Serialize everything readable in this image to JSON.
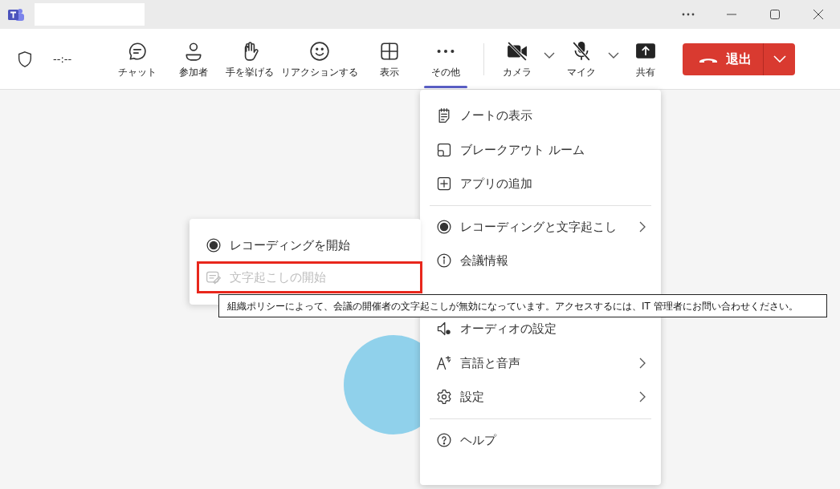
{
  "title_bar": {
    "controls": [
      {
        "kind": "more"
      },
      {
        "kind": "minimize"
      },
      {
        "kind": "maximize"
      },
      {
        "kind": "close"
      }
    ]
  },
  "toolbar": {
    "timer": "--:--",
    "buttons": [
      {
        "label": "チャット",
        "selected": false
      },
      {
        "label": "参加者",
        "selected": false
      },
      {
        "label": "手を挙げる",
        "selected": false
      },
      {
        "label": "リアクションする",
        "selected": false
      },
      {
        "label": "表示",
        "selected": false
      },
      {
        "label": "その他",
        "selected": true
      }
    ],
    "devices": [
      {
        "label": "カメラ",
        "has_menu": true
      },
      {
        "label": "マイク",
        "has_menu": true
      },
      {
        "label": "共有",
        "has_menu": false
      }
    ],
    "leave_button": {
      "label": "退出"
    }
  },
  "more_menu": {
    "items": [
      {
        "kind": "item",
        "label": "ノートの表示",
        "has_submenu": false
      },
      {
        "kind": "item",
        "label": "ブレークアウト ルーム",
        "has_submenu": false
      },
      {
        "kind": "item",
        "label": "アプリの追加",
        "has_submenu": false
      },
      {
        "kind": "divider"
      },
      {
        "kind": "item",
        "label": "レコーディングと文字起こし",
        "has_submenu": true
      },
      {
        "kind": "item",
        "label": "会議情報",
        "has_submenu": false
      },
      {
        "kind": "item",
        "label": "オーディオの設定",
        "has_submenu": false
      },
      {
        "kind": "item",
        "label": "言語と音声",
        "has_submenu": true
      },
      {
        "kind": "item",
        "label": "設定",
        "has_submenu": true
      },
      {
        "kind": "divider"
      },
      {
        "kind": "item",
        "label": "ヘルプ",
        "has_submenu": false
      }
    ]
  },
  "submenu": {
    "items": [
      {
        "label": "レコーディングを開始",
        "disabled": false,
        "highlighted": false
      },
      {
        "label": "文字起こしの開始",
        "disabled": true,
        "highlighted": true
      }
    ]
  },
  "tooltip": {
    "text": "組織ポリシーによって、会議の開催者の文字起こしが無効になっています。アクセスするには、IT 管理者にお問い合わせください。"
  }
}
